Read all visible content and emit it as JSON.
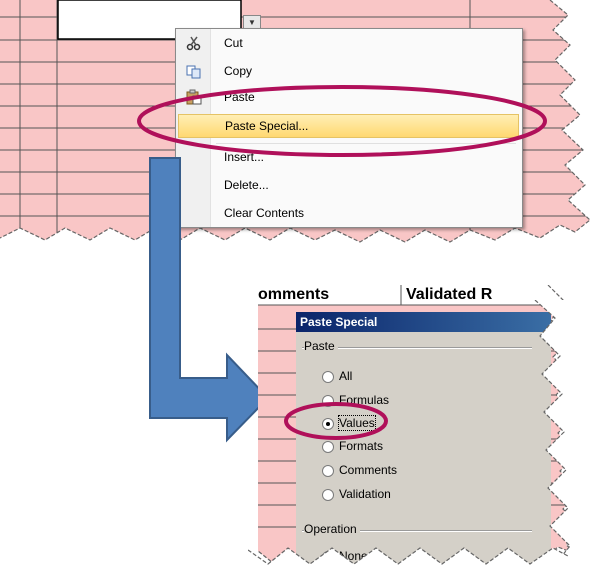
{
  "context_menu": {
    "items": [
      {
        "label": "Cut",
        "icon": "scissors-icon"
      },
      {
        "label": "Copy",
        "icon": "copy-icon"
      },
      {
        "label": "Paste",
        "icon": "paste-icon"
      },
      {
        "label": "Paste Special...",
        "icon": "",
        "highlighted": true
      },
      {
        "label": "Insert...",
        "icon": ""
      },
      {
        "label": "Delete...",
        "icon": ""
      },
      {
        "label": "Clear Contents",
        "icon": ""
      }
    ],
    "dropdown_arrow": "▼"
  },
  "sheet": {
    "columns": [
      "omments",
      "Validated R"
    ]
  },
  "dialog": {
    "title": "Paste Special",
    "paste_group": "Paste",
    "paste_options": [
      "All",
      "Formulas",
      "Values",
      "Formats",
      "Comments",
      "Validation"
    ],
    "selected_option": "Values",
    "operation_group": "Operation",
    "operation_first": "None"
  },
  "colors": {
    "cell_fill": "#f9c6c6",
    "highlight_ellipse": "#b0105a",
    "arrow_fill": "#4f81bd",
    "arrow_stroke": "#385d8a",
    "menu_highlight": "#ffd871",
    "dialog_title": "#0a246a"
  }
}
